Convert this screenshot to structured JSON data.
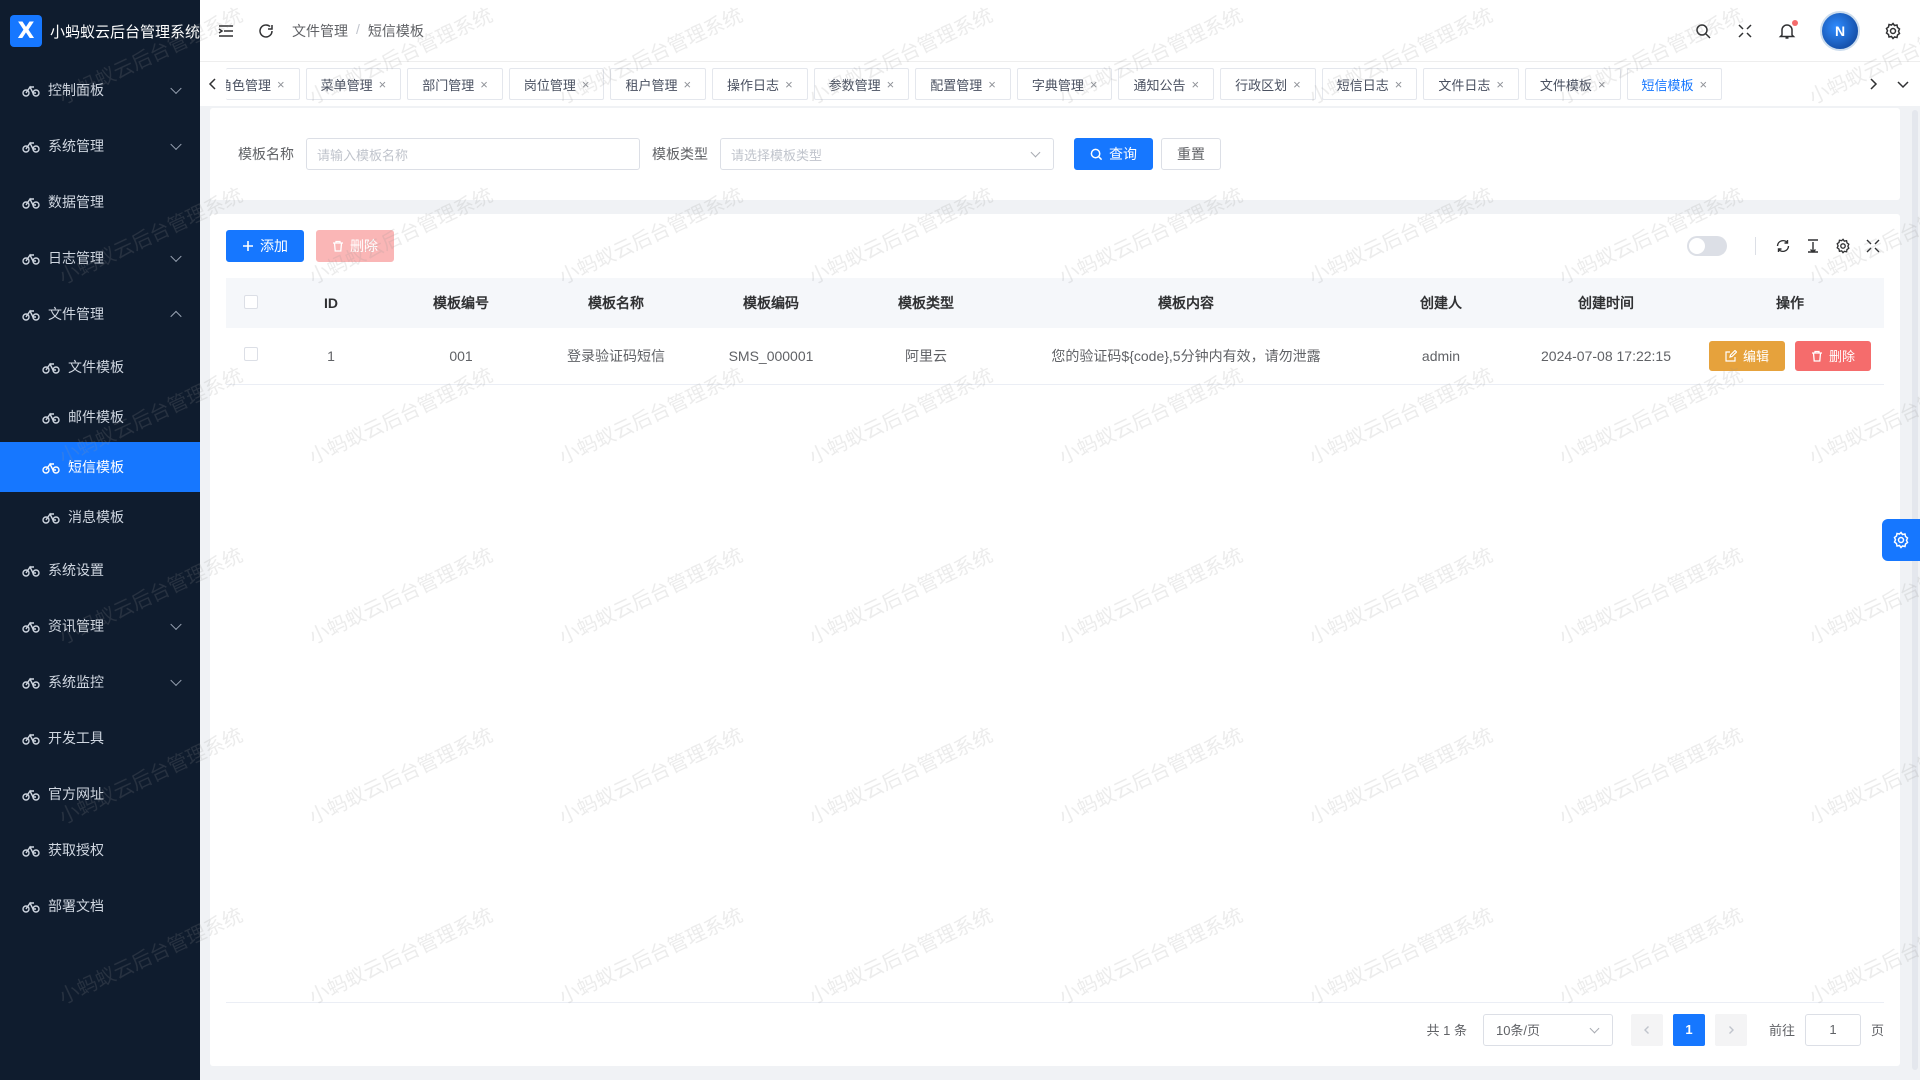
{
  "app": {
    "title": "小蚂蚁云后台管理系统",
    "logo_letter": "X"
  },
  "sidebar": {
    "items": [
      {
        "label": "控制面板",
        "icon": "bike-icon",
        "arrow": "down"
      },
      {
        "label": "系统管理",
        "icon": "bike-icon",
        "arrow": "down"
      },
      {
        "label": "数据管理",
        "icon": "bike-icon",
        "arrow": ""
      },
      {
        "label": "日志管理",
        "icon": "bike-icon",
        "arrow": "down"
      },
      {
        "label": "文件管理",
        "icon": "bike-icon",
        "arrow": "up"
      }
    ],
    "sub_items": [
      {
        "label": "文件模板",
        "active": false
      },
      {
        "label": "邮件模板",
        "active": false
      },
      {
        "label": "短信模板",
        "active": true
      },
      {
        "label": "消息模板",
        "active": false
      }
    ],
    "items_after": [
      {
        "label": "系统设置",
        "arrow": ""
      },
      {
        "label": "资讯管理",
        "arrow": "down"
      },
      {
        "label": "系统监控",
        "arrow": "down"
      },
      {
        "label": "开发工具",
        "arrow": ""
      },
      {
        "label": "官方网址",
        "arrow": ""
      },
      {
        "label": "获取授权",
        "arrow": ""
      },
      {
        "label": "部署文档",
        "arrow": ""
      }
    ]
  },
  "header": {
    "breadcrumb": [
      "文件管理",
      "短信模板"
    ],
    "breadcrumb_sep": "/",
    "avatar_letter": "N"
  },
  "tabs": [
    "角色管理",
    "菜单管理",
    "部门管理",
    "岗位管理",
    "租户管理",
    "操作日志",
    "参数管理",
    "配置管理",
    "字典管理",
    "通知公告",
    "行政区划",
    "短信日志",
    "文件日志",
    "文件模板",
    "短信模板"
  ],
  "tab_close": "×",
  "active_tab": "短信模板",
  "search": {
    "name_label": "模板名称",
    "name_placeholder": "请输入模板名称",
    "type_label": "模板类型",
    "type_placeholder": "请选择模板类型",
    "query_label": "查询",
    "reset_label": "重置"
  },
  "toolbar": {
    "add_label": "添加",
    "delete_label": "删除"
  },
  "table": {
    "columns": [
      "",
      "ID",
      "模板编号",
      "模板名称",
      "模板编码",
      "模板类型",
      "模板内容",
      "创建人",
      "创建时间",
      "操作"
    ],
    "rows": [
      {
        "id": "1",
        "number": "001",
        "name": "登录验证码短信",
        "code": "SMS_000001",
        "type": "阿里云",
        "content": "您的验证码${code},5分钟内有效，请勿泄露",
        "creator": "admin",
        "created": "2024-07-08 17:22:15",
        "edit": "编辑",
        "delete": "删除"
      }
    ]
  },
  "pagination": {
    "total": "共 1 条",
    "page_size": "10条/页",
    "current": "1",
    "goto_label": "前往",
    "goto_value": "1",
    "page_suffix": "页"
  },
  "watermark_text": "小蚂蚁云后台管理系统",
  "colors": {
    "primary": "#1677ff",
    "sidebar_bg": "#0f1c2e",
    "warning": "#e6a23c",
    "danger": "#f56c6c"
  }
}
